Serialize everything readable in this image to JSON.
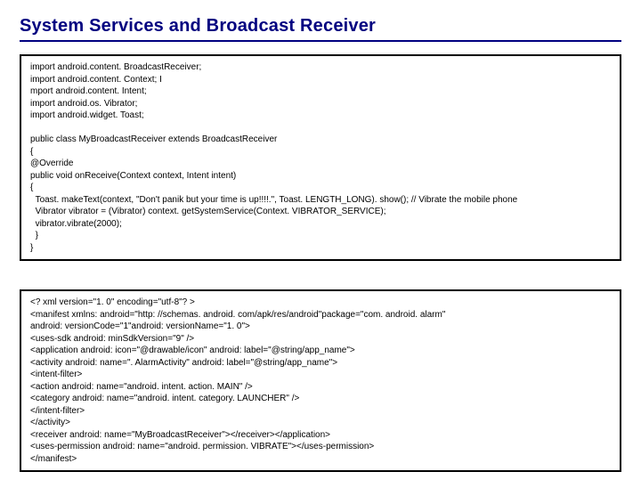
{
  "title": "System Services and Broadcast Receiver",
  "code1": "import android.content. BroadcastReceiver;\nimport android.content. Context; I\nmport android.content. Intent;\nimport android.os. Vibrator;\nimport android.widget. Toast;\n\npublic class MyBroadcastReceiver extends BroadcastReceiver\n{\n@Override\npublic void onReceive(Context context, Intent intent)\n{\n  Toast. makeText(context, \"Don't panik but your time is up!!!!.\", Toast. LENGTH_LONG). show(); // Vibrate the mobile phone\n  Vibrator vibrator = (Vibrator) context. getSystemService(Context. VIBRATOR_SERVICE);\n  vibrator.vibrate(2000);\n  }\n}",
  "code2": "<? xml version=\"1. 0\" encoding=\"utf-8\"? >\n<manifest xmlns: android=\"http: //schemas. android. com/apk/res/android\"package=\"com. android. alarm\"\nandroid: versionCode=\"1\"android: versionName=\"1. 0\">\n<uses-sdk android: minSdkVersion=\"9\" />\n<application android: icon=\"@drawable/icon\" android: label=\"@string/app_name\">\n<activity android: name=\". AlarmActivity\" android: label=\"@string/app_name\">\n<intent-filter>\n<action android: name=\"android. intent. action. MAIN\" />\n<category android: name=\"android. intent. category. LAUNCHER\" />\n</intent-filter>\n</activity>\n<receiver android: name=\"MyBroadcastReceiver\"></receiver></application>\n<uses-permission android: name=\"android. permission. VIBRATE\"></uses-permission>\n</manifest>"
}
